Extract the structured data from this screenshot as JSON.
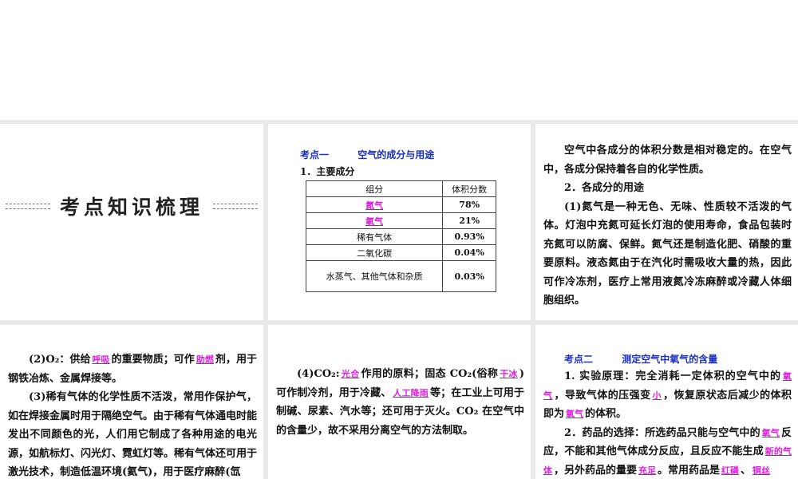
{
  "section_title": "考点知识梳理",
  "topic1": {
    "label": "考点一",
    "title": "空气的成分与用途",
    "sub1": "1．主要成分",
    "table": {
      "headers": [
        "组分",
        "体积分数"
      ],
      "rows": [
        {
          "name": "氮气",
          "value": "78%",
          "blank": true
        },
        {
          "name": "氧气",
          "value": "21%",
          "blank": true
        },
        {
          "name": "稀有气体",
          "value": "0.93%",
          "blank": false
        },
        {
          "name": "二氧化碳",
          "value": "0.04%",
          "blank": false
        },
        {
          "name": "水蒸气、其他气体和杂质",
          "value": "0.03%",
          "blank": false
        }
      ]
    }
  },
  "panel3": [
    [
      {
        "t": "空气中各成分的体积分数是相对稳定的。在空气中，各成分保持着各自的化学性质。"
      }
    ],
    [
      {
        "t": "2．各成分的用途"
      }
    ],
    [
      {
        "t": "(1)氮气是一种无色、无味、性质较不活泼的气体。灯泡中充氮可延长灯泡的使用寿命，食品包装时充氮可以防腐、保鲜。氮气还是制造化肥、硝酸的重要原料。液态氮由于在汽化时需吸收大量的热，因此可作冷冻剂，医疗上常用液氮冷冻麻醉或冷藏人体细胞组织。"
      }
    ]
  ],
  "panel4": [
    [
      {
        "t": "(2)O₂：供给"
      },
      {
        "t": "呼吸",
        "hl": true
      },
      {
        "t": "的重要物质；可作"
      },
      {
        "t": "助燃",
        "hl": true
      },
      {
        "t": "剂，用于钢铁冶炼、金属焊接等。"
      }
    ],
    [
      {
        "t": "(3)稀有气体的化学性质不活泼，常用作保护气，如在焊接金属时用于隔绝空气。由于稀有气体通电时能发出不同颜色的光，人们用它制成了各种用途的电光源，如航标灯、闪光灯、霓虹灯等。稀有气体还可用于激光技术，制造低温环境(氦气)，用于医疗麻醉(氙"
      }
    ]
  ],
  "panel5": [
    [
      {
        "t": "(4)CO₂:"
      },
      {
        "t": "光合",
        "hl": true
      },
      {
        "t": "作用的原料；固态 CO₂(俗称"
      },
      {
        "t": "干冰",
        "hl": true
      },
      {
        "t": ")可作制冷剂，用于冷藏、"
      },
      {
        "t": "人工降雨",
        "hl": true
      },
      {
        "t": "等；在工业上可用于制碱、尿素、汽水等；还可用于灭火。CO₂ 在空气中的含量少，故不采用分离空气的方法制取。"
      }
    ]
  ],
  "topic2": {
    "label": "考点二",
    "title": "测定空气中氧气的含量"
  },
  "panel6": [
    [
      {
        "t": "1. 实验原理：完全消耗一定体积的空气中的"
      },
      {
        "t": "氧气",
        "hl": true
      },
      {
        "t": "，导致气体的压强变"
      },
      {
        "t": "小",
        "hl": true
      },
      {
        "t": "，恢复原状态后减少的体积即为"
      },
      {
        "t": "氧气",
        "hl": true
      },
      {
        "t": "的体积。"
      }
    ],
    [
      {
        "t": "2．药品的选择：所选药品只能与空气中的"
      },
      {
        "t": "氧气",
        "hl": true
      },
      {
        "t": "反应，不能和其他气体成分反应，且反应不能生成"
      },
      {
        "t": "新的气体",
        "hl": true
      },
      {
        "t": "，另外药品的量要"
      },
      {
        "t": "充足",
        "hl": true
      },
      {
        "t": "。常用药品是"
      },
      {
        "t": "红磷",
        "hl": true
      },
      {
        "t": "、"
      },
      {
        "t": "铜丝",
        "hl": true
      }
    ]
  ]
}
